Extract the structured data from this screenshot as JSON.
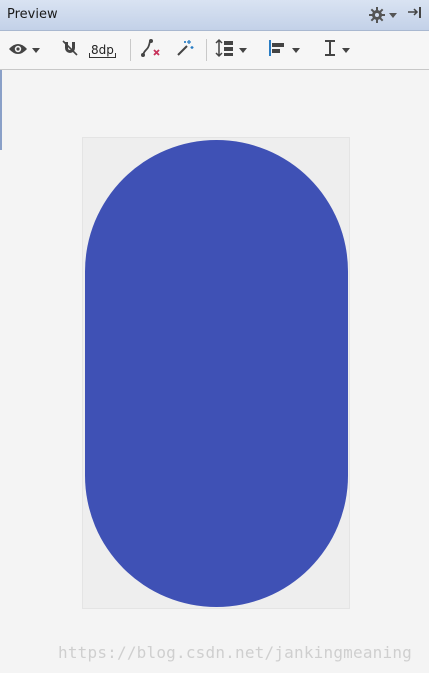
{
  "panel": {
    "title": "Preview"
  },
  "icons": {
    "visibility": "eye-icon",
    "autoconnect": "magnet-off-icon",
    "clear_constraints": "clear-constraints-icon",
    "infer_constraints": "magic-wand-icon",
    "pack": "pack-vertical-icon",
    "align": "align-left-icon",
    "guidelines": "guidelines-icon",
    "settings": "gear-icon",
    "hide": "hide-panel-icon"
  },
  "toolbar": {
    "margin_label": "8dp"
  },
  "shape": {
    "color": "#3f51b5"
  },
  "watermark": "https://blog.csdn.net/jankingmeaning"
}
